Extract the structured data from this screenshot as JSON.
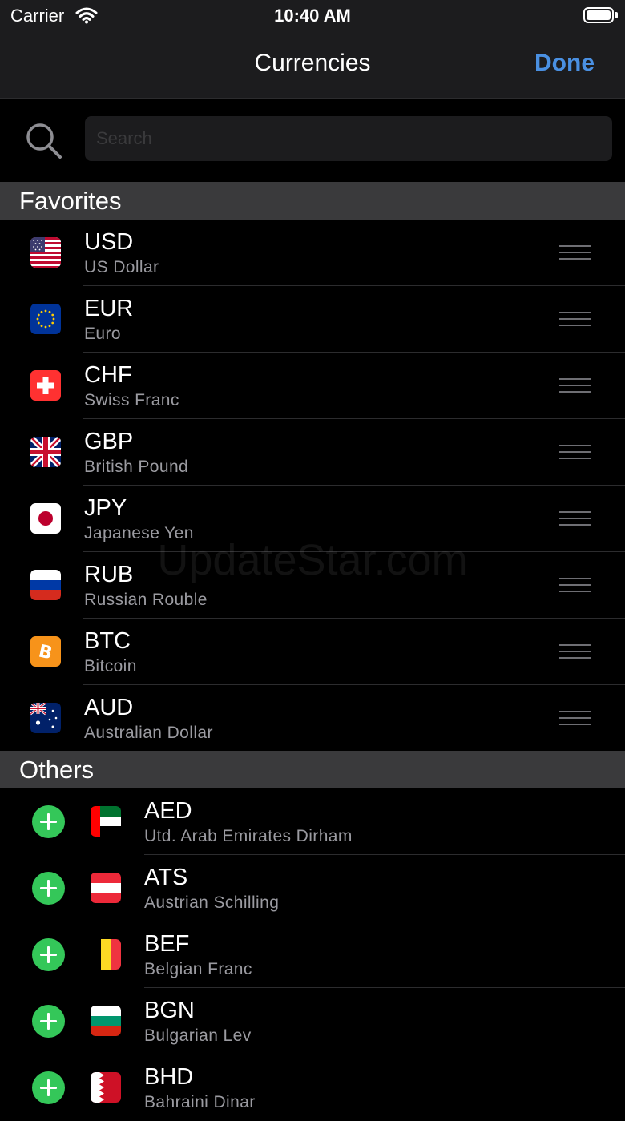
{
  "status_bar": {
    "carrier": "Carrier",
    "time": "10:40 AM"
  },
  "nav": {
    "title": "Currencies",
    "done_label": "Done"
  },
  "search": {
    "placeholder": "Search",
    "value": ""
  },
  "favorites": {
    "header": "Favorites",
    "items": [
      {
        "code": "USD",
        "name": "US Dollar",
        "flag": "us-flag-icon"
      },
      {
        "code": "EUR",
        "name": "Euro",
        "flag": "eu-flag-icon"
      },
      {
        "code": "CHF",
        "name": "Swiss Franc",
        "flag": "ch-flag-icon"
      },
      {
        "code": "GBP",
        "name": "British Pound",
        "flag": "gb-flag-icon"
      },
      {
        "code": "JPY",
        "name": "Japanese Yen",
        "flag": "jp-flag-icon"
      },
      {
        "code": "RUB",
        "name": "Russian Rouble",
        "flag": "ru-flag-icon"
      },
      {
        "code": "BTC",
        "name": "Bitcoin",
        "flag": "bitcoin-icon"
      },
      {
        "code": "AUD",
        "name": "Australian Dollar",
        "flag": "au-flag-icon"
      }
    ]
  },
  "others": {
    "header": "Others",
    "items": [
      {
        "code": "AED",
        "name": "Utd. Arab Emirates Dirham",
        "flag": "ae-flag-icon"
      },
      {
        "code": "ATS",
        "name": "Austrian Schilling",
        "flag": "at-flag-icon"
      },
      {
        "code": "BEF",
        "name": "Belgian Franc",
        "flag": "be-flag-icon"
      },
      {
        "code": "BGN",
        "name": "Bulgarian Lev",
        "flag": "bg-flag-icon"
      },
      {
        "code": "BHD",
        "name": "Bahraini Dinar",
        "flag": "bh-flag-icon"
      }
    ]
  },
  "watermark": "UpdateStar.com",
  "colors": {
    "accent": "#4a90e2",
    "add_green": "#34c759",
    "section_bg": "#3a3a3c",
    "background": "#000000"
  }
}
